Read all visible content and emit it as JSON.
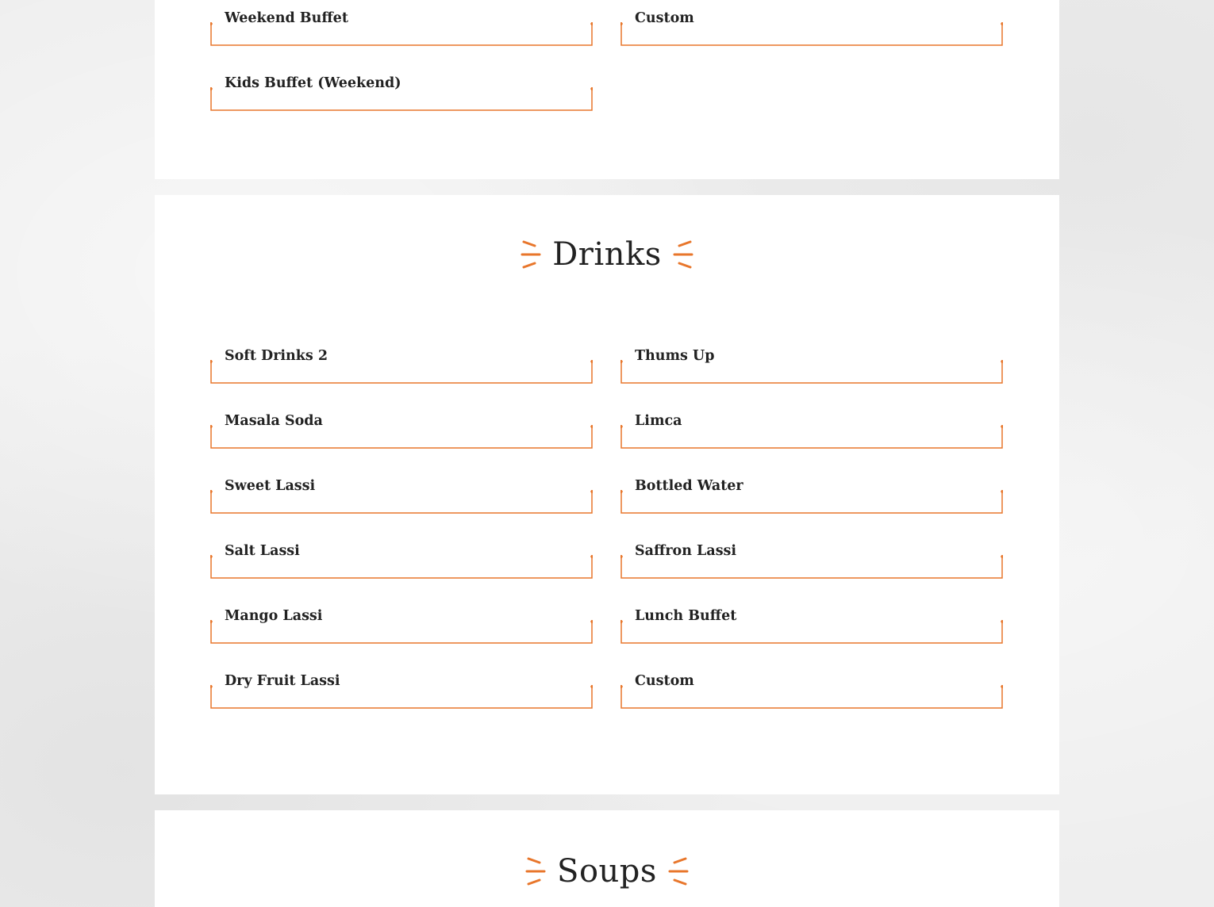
{
  "colors": {
    "accent": "#e8762b",
    "text": "#222222",
    "card": "#ffffff",
    "background": "#eeeeee"
  },
  "buffet_section": {
    "items": [
      {
        "label": "Weekend Buffet"
      },
      {
        "label": "Custom"
      },
      {
        "label": "Kids Buffet (Weekend)"
      }
    ]
  },
  "drinks_section": {
    "title": "Drinks",
    "items": [
      {
        "label": "Soft Drinks 2"
      },
      {
        "label": "Thums Up"
      },
      {
        "label": "Masala Soda"
      },
      {
        "label": "Limca"
      },
      {
        "label": "Sweet Lassi"
      },
      {
        "label": "Bottled Water"
      },
      {
        "label": "Salt Lassi"
      },
      {
        "label": "Saffron Lassi"
      },
      {
        "label": "Mango Lassi"
      },
      {
        "label": "Lunch Buffet"
      },
      {
        "label": "Dry Fruit Lassi"
      },
      {
        "label": "Custom"
      }
    ]
  },
  "soups_section": {
    "title": "Soups"
  }
}
